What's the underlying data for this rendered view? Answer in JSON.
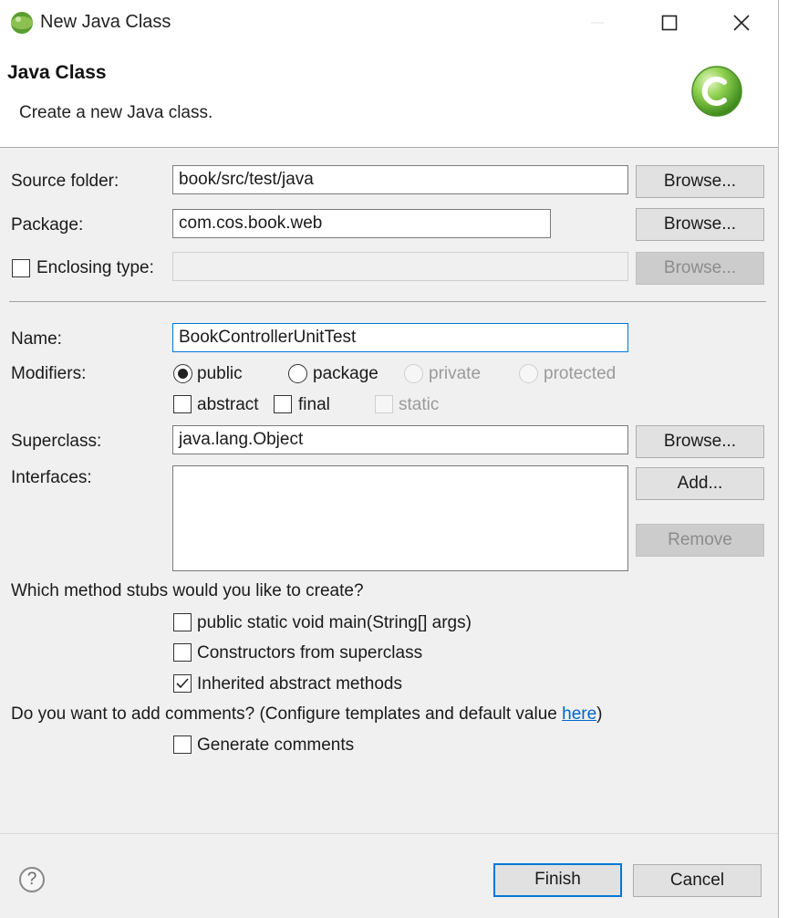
{
  "window": {
    "title": "New Java Class",
    "icon": "eclipse-icon",
    "controls": [
      "minimize-icon",
      "maximize-icon",
      "close-icon"
    ]
  },
  "banner": {
    "title": "Java Class",
    "description": "Create a new Java class.",
    "icon": "java-class-icon"
  },
  "source_folder": {
    "label": "Source folder:",
    "value": "book/src/test/java",
    "browse": "Browse..."
  },
  "package": {
    "label": "Package:",
    "value": "com.cos.book.web",
    "browse": "Browse..."
  },
  "enclosing_type": {
    "label": "Enclosing type:",
    "checked": false,
    "value": "",
    "browse": "Browse..."
  },
  "name": {
    "label": "Name:",
    "value": "BookControllerUnitTest"
  },
  "modifiers": {
    "label": "Modifiers:",
    "access": [
      {
        "label": "public",
        "selected": true,
        "enabled": true
      },
      {
        "label": "package",
        "selected": false,
        "enabled": true
      },
      {
        "label": "private",
        "selected": false,
        "enabled": false
      },
      {
        "label": "protected",
        "selected": false,
        "enabled": false
      }
    ],
    "flags": [
      {
        "label": "abstract",
        "checked": false,
        "enabled": true
      },
      {
        "label": "final",
        "checked": false,
        "enabled": true
      },
      {
        "label": "static",
        "checked": false,
        "enabled": false
      }
    ]
  },
  "superclass": {
    "label": "Superclass:",
    "value": "java.lang.Object",
    "browse": "Browse..."
  },
  "interfaces": {
    "label": "Interfaces:",
    "add": "Add...",
    "remove": "Remove"
  },
  "stubs": {
    "question": "Which method stubs would you like to create?",
    "options": [
      {
        "label": "public static void main(String[] args)",
        "checked": false
      },
      {
        "label": "Constructors from superclass",
        "checked": false
      },
      {
        "label": "Inherited abstract methods",
        "checked": true
      }
    ]
  },
  "comments": {
    "question_prefix": "Do you want to add comments? (Configure templates and default value ",
    "link": "here",
    "question_suffix": ")",
    "option": {
      "label": "Generate comments",
      "checked": false
    }
  },
  "footer": {
    "help": "?",
    "finish": "Finish",
    "cancel": "Cancel"
  },
  "colors": {
    "accent": "#0078d7",
    "link": "#0066cc",
    "icon_green": "#7cc242"
  }
}
